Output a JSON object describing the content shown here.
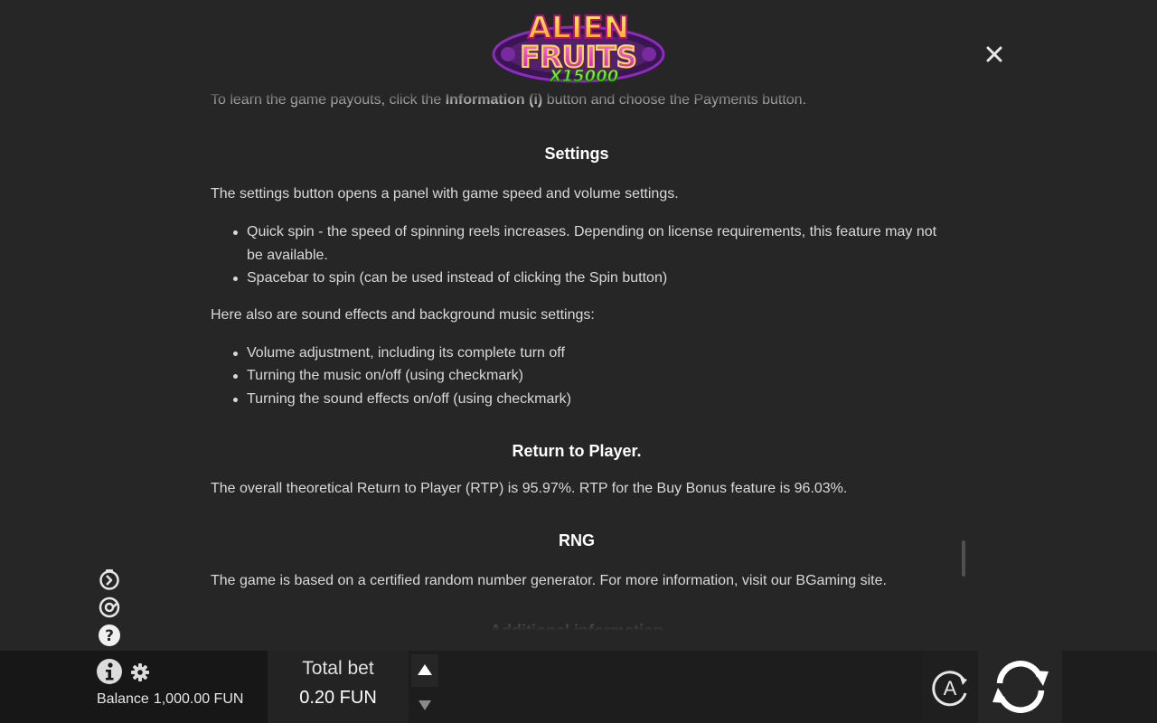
{
  "header": {
    "logo": {
      "line1": "ALIEN",
      "line2": "FRUITS",
      "multiplier": "X15000"
    },
    "close_icon": "close-icon"
  },
  "rules": {
    "intro": {
      "before": "To learn the game payouts, click the ",
      "bold": "Information (i)",
      "after": " button and choose the Payments button."
    },
    "settings": {
      "title": "Settings",
      "text": "The settings button opens a panel with game speed and volume settings.",
      "list": [
        "Quick spin - the speed of spinning reels increases. Depending on license requirements, this feature may not be available.",
        "Spacebar to spin (can be used instead of clicking the Spin button)"
      ],
      "sound_text": "Here also are sound effects and background music settings:",
      "sound_list": [
        "Volume adjustment, including its complete turn off",
        "Turning the music on/off (using checkmark)",
        "Turning the sound effects on/off (using checkmark)"
      ]
    },
    "rtp": {
      "title": "Return to Player.",
      "text": "The overall theoretical Return to Player (RTP) is 95.97%. RTP for the Buy Bonus feature is 96.03%."
    },
    "rng": {
      "title": "RNG",
      "text": "The game is based on a certified random number generator. For more information, visit our BGaming site."
    },
    "additional": {
      "title": "Additional information"
    }
  },
  "side_icons": [
    "turbo-icon",
    "history-icon",
    "help-icon"
  ],
  "bottom_bar": {
    "balance_label": "Balance",
    "balance_value": "1,000.00 FUN",
    "bet_label": "Total bet",
    "bet_value": "0.20 FUN",
    "auto_label": "A"
  },
  "colors": {
    "background": "#262626",
    "bar": "#1d1d1d",
    "heading": "#ffffff",
    "text": "#d9d9d9"
  }
}
